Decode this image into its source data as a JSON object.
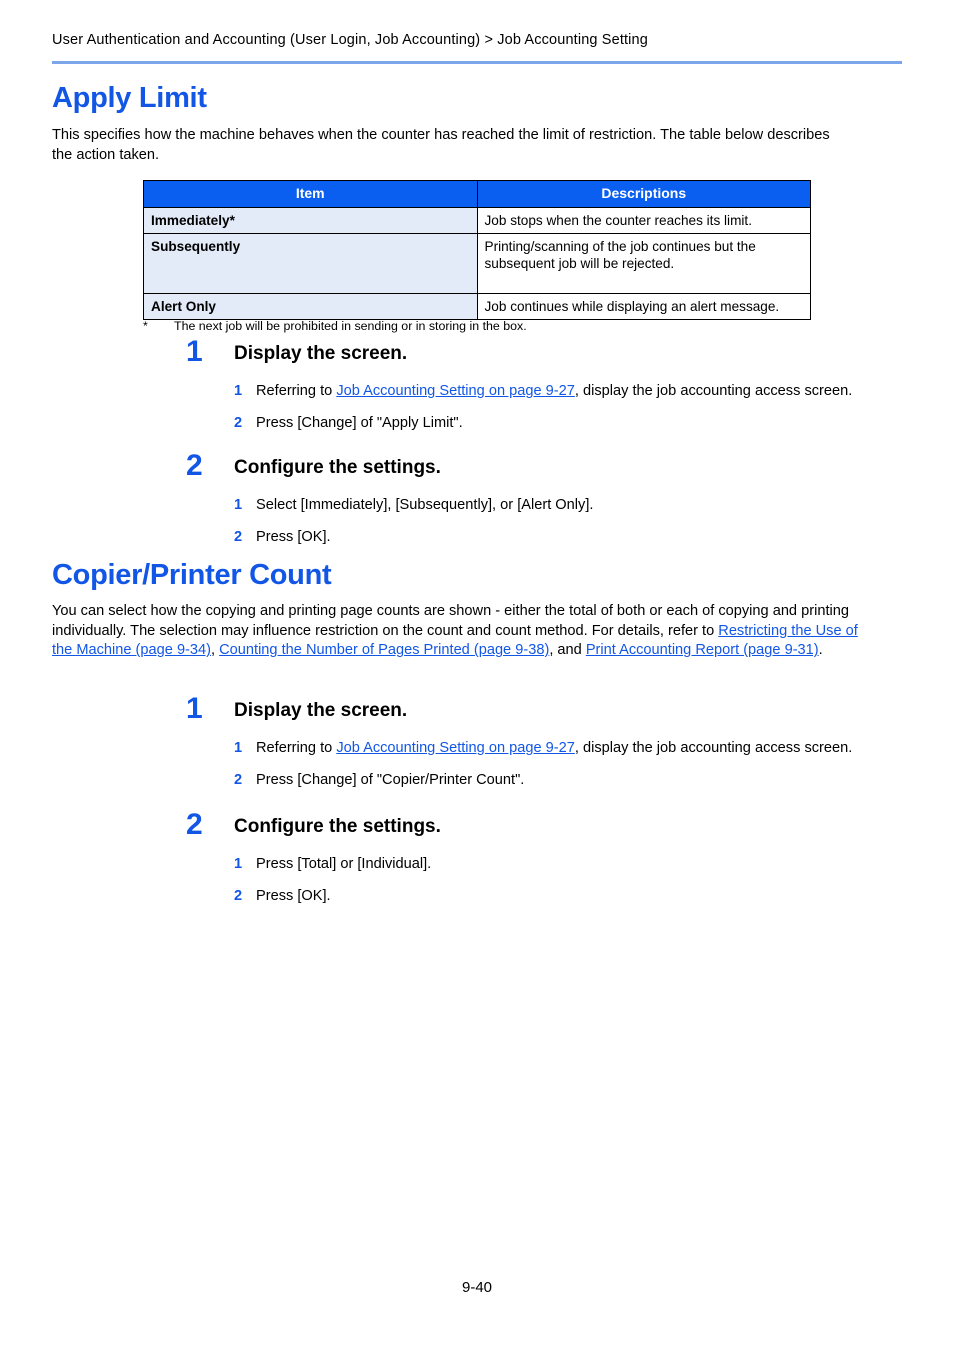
{
  "header": {
    "breadcrumb": "User Authentication and Accounting (User Login, Job Accounting) > Job Accounting Setting"
  },
  "colors": {
    "heading_blue": "#1256e6",
    "table_header_blue": "#0a5ff0",
    "item_cell_blue": "#e3eaf8",
    "rule_blue": "#7ba7ea",
    "link_blue": "#1256e6"
  },
  "sections": {
    "apply_limit": {
      "title": "Apply Limit",
      "intro": "This specifies how the machine behaves when the counter has reached the limit of restriction. The table below describes the action taken.",
      "table": {
        "columns": [
          "Item",
          "Descriptions"
        ],
        "rows": [
          {
            "item": "Immediately*",
            "description": "Job stops when the counter reaches its limit."
          },
          {
            "item": "Subsequently",
            "description": "Printing/scanning of the job continues but the subsequent job will be rejected."
          },
          {
            "item": "Alert Only",
            "description": "Job continues while displaying an alert message."
          }
        ]
      },
      "footnote": {
        "mark": "*",
        "text": "The next job will be prohibited in sending or in storing in the box."
      },
      "steps": [
        {
          "number": "1",
          "title": "Display the screen.",
          "substeps": [
            {
              "number": "1",
              "prefix": "Referring to ",
              "link": "Job Accounting Setting on page 9-27",
              "suffix": ", display the job accounting access screen."
            },
            {
              "number": "2",
              "prefix": "Press [Change] of \"Apply Limit\".",
              "link": "",
              "suffix": ""
            }
          ]
        },
        {
          "number": "2",
          "title": "Configure the settings.",
          "substeps": [
            {
              "number": "1",
              "prefix": "Select [Immediately], [Subsequently], or [Alert Only].",
              "link": "",
              "suffix": ""
            },
            {
              "number": "2",
              "prefix": "Press [OK].",
              "link": "",
              "suffix": ""
            }
          ]
        }
      ]
    },
    "copier_printer_count": {
      "title": "Copier/Printer Count",
      "intro_part1": "You can select how the copying and printing page counts are shown - either the total of both or each of copying and printing individually. The selection may influence restriction on the count and count method. For details, refer to ",
      "intro_link1": "Restricting the Use of the Machine (page 9-34)",
      "intro_sep1": ", ",
      "intro_link2": "Counting the Number of Pages Printed (page 9-38)",
      "intro_sep2": ", and ",
      "intro_link3": "Print Accounting Report (page 9-31)",
      "intro_end": ".",
      "steps": [
        {
          "number": "1",
          "title": "Display the screen.",
          "substeps": [
            {
              "number": "1",
              "prefix": "Referring to ",
              "link": "Job Accounting Setting on page 9-27",
              "suffix": ", display the job accounting access screen."
            },
            {
              "number": "2",
              "prefix": "Press [Change] of \"Copier/Printer Count\".",
              "link": "",
              "suffix": ""
            }
          ]
        },
        {
          "number": "2",
          "title": "Configure the settings.",
          "substeps": [
            {
              "number": "1",
              "prefix": "Press [Total] or [Individual].",
              "link": "",
              "suffix": ""
            },
            {
              "number": "2",
              "prefix": "Press [OK].",
              "link": "",
              "suffix": ""
            }
          ]
        }
      ]
    }
  },
  "footer": {
    "page_number": "9-40"
  }
}
